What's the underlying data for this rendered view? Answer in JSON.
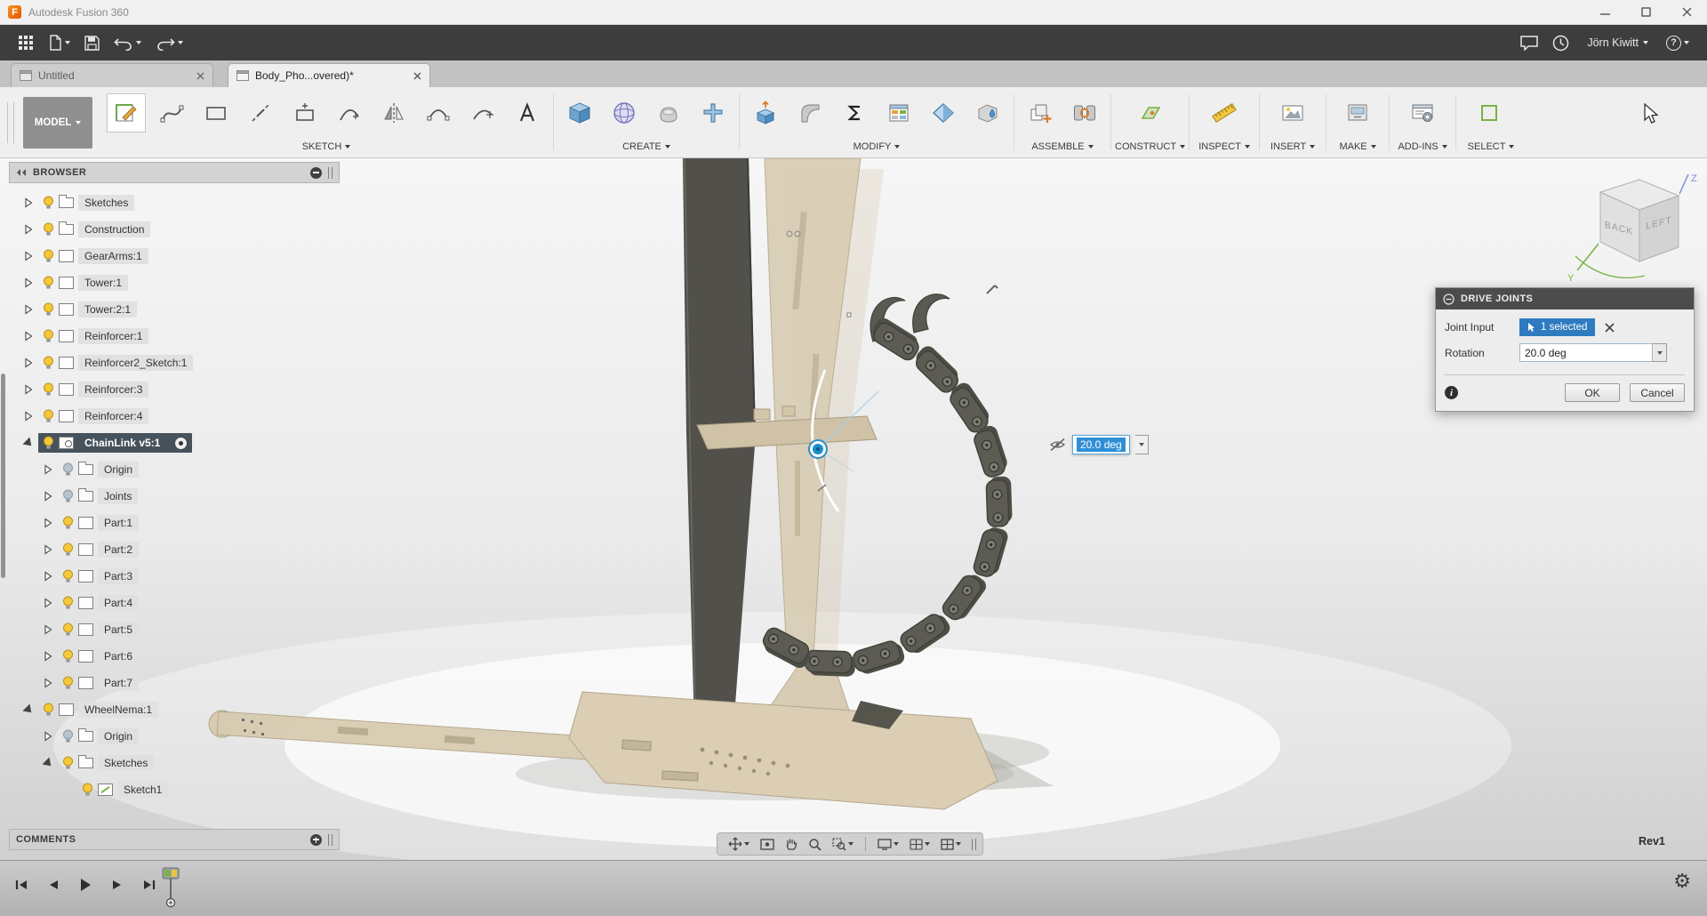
{
  "titlebar": {
    "logo_letter": "F",
    "title": "Autodesk Fusion 360"
  },
  "appbar": {
    "user_name": "Jörn Kiwitt",
    "help_label": "?"
  },
  "tabs": {
    "items": [
      {
        "label": "Untitled",
        "active": false
      },
      {
        "label": "Body_Pho...overed)*",
        "active": true
      }
    ]
  },
  "ribbon": {
    "mode_button": "MODEL",
    "groups": [
      {
        "label": "SKETCH"
      },
      {
        "label": "CREATE"
      },
      {
        "label": "MODIFY"
      },
      {
        "label": "ASSEMBLE"
      },
      {
        "label": "CONSTRUCT"
      },
      {
        "label": "INSPECT"
      },
      {
        "label": "INSERT"
      },
      {
        "label": "MAKE"
      },
      {
        "label": "ADD-INS"
      },
      {
        "label": "SELECT"
      }
    ]
  },
  "browser": {
    "title": "BROWSER",
    "items": [
      {
        "label": "Sketches",
        "depth": 0,
        "arrow": "collapsed",
        "bulb": "on",
        "icon": "folder"
      },
      {
        "label": "Construction",
        "depth": 0,
        "arrow": "collapsed",
        "bulb": "on",
        "icon": "folder"
      },
      {
        "label": "GearArms:1",
        "depth": 0,
        "arrow": "collapsed",
        "bulb": "on",
        "icon": "component"
      },
      {
        "label": "Tower:1",
        "depth": 0,
        "arrow": "collapsed",
        "bulb": "on",
        "icon": "component"
      },
      {
        "label": "Tower:2:1",
        "depth": 0,
        "arrow": "collapsed",
        "bulb": "on",
        "icon": "component"
      },
      {
        "label": "Reinforcer:1",
        "depth": 0,
        "arrow": "collapsed",
        "bulb": "on",
        "icon": "component"
      },
      {
        "label": "Reinforcer2_Sketch:1",
        "depth": 0,
        "arrow": "collapsed",
        "bulb": "on",
        "icon": "component"
      },
      {
        "label": "Reinforcer:3",
        "depth": 0,
        "arrow": "collapsed",
        "bulb": "on",
        "icon": "component"
      },
      {
        "label": "Reinforcer:4",
        "depth": 0,
        "arrow": "collapsed",
        "bulb": "on",
        "icon": "component"
      },
      {
        "label": "ChainLink v5:1",
        "depth": 0,
        "arrow": "expanded",
        "bulb": "on",
        "icon": "component-link",
        "selected": true,
        "radio": true
      },
      {
        "label": "Origin",
        "depth": 1,
        "arrow": "collapsed",
        "bulb": "off",
        "icon": "folder"
      },
      {
        "label": "Joints",
        "depth": 1,
        "arrow": "collapsed",
        "bulb": "off",
        "icon": "folder"
      },
      {
        "label": "Part:1",
        "depth": 1,
        "arrow": "collapsed",
        "bulb": "on",
        "icon": "component"
      },
      {
        "label": "Part:2",
        "depth": 1,
        "arrow": "collapsed",
        "bulb": "on",
        "icon": "component"
      },
      {
        "label": "Part:3",
        "depth": 1,
        "arrow": "collapsed",
        "bulb": "on",
        "icon": "component"
      },
      {
        "label": "Part:4",
        "depth": 1,
        "arrow": "collapsed",
        "bulb": "on",
        "icon": "component"
      },
      {
        "label": "Part:5",
        "depth": 1,
        "arrow": "collapsed",
        "bulb": "on",
        "icon": "component"
      },
      {
        "label": "Part:6",
        "depth": 1,
        "arrow": "collapsed",
        "bulb": "on",
        "icon": "component"
      },
      {
        "label": "Part:7",
        "depth": 1,
        "arrow": "collapsed",
        "bulb": "on",
        "icon": "component"
      },
      {
        "label": "WheelNema:1",
        "depth": 0,
        "arrow": "expanded",
        "bulb": "on",
        "icon": "component"
      },
      {
        "label": "Origin",
        "depth": 1,
        "arrow": "collapsed",
        "bulb": "off",
        "icon": "folder"
      },
      {
        "label": "Sketches",
        "depth": 1,
        "arrow": "expanded",
        "bulb": "on",
        "icon": "folder"
      },
      {
        "label": "Sketch1",
        "depth": 2,
        "arrow": "none",
        "bulb": "on",
        "icon": "sketch"
      }
    ]
  },
  "comments": {
    "title": "COMMENTS"
  },
  "drive_joints": {
    "title": "DRIVE JOINTS",
    "joint_input_label": "Joint Input",
    "joint_input_value": "1 selected",
    "rotation_label": "Rotation",
    "rotation_value": "20.0 deg",
    "ok_label": "OK",
    "cancel_label": "Cancel"
  },
  "canvas": {
    "manipulator_value": "20.0 deg",
    "revision": "Rev1",
    "viewcube": {
      "back": "BACK",
      "left": "LEFT",
      "axis_y": "Y",
      "axis_z": "Z"
    }
  }
}
